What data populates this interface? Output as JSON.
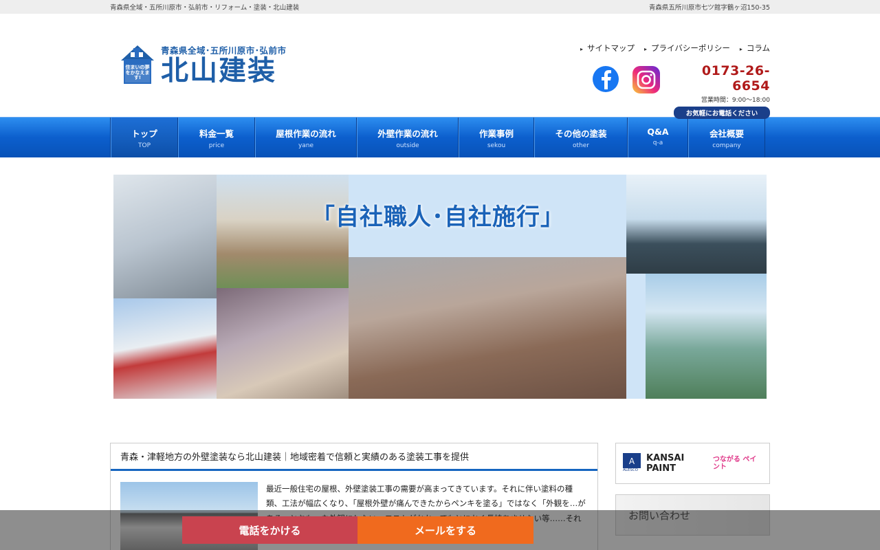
{
  "topbar": {
    "left": "青森県全域・五所川原市・弘前市・リフォーム・塗装・北山建装",
    "right": "青森県五所川原市七ツ館字鶴ヶ沼150-35"
  },
  "logo": {
    "sub": "青森県全域･五所川原市･弘前市",
    "main": "北山建装",
    "tagline": "住まいの夢をかなえます!"
  },
  "header_links": [
    "サイトマップ",
    "プライバシーポリシー",
    "コラム"
  ],
  "social": {
    "facebook": "facebook-icon",
    "instagram": "instagram-icon"
  },
  "contact": {
    "phone": "0173-26-6654",
    "hours": "営業時間：9:00〜18:00",
    "note": "お気軽にお電話ください"
  },
  "nav": [
    {
      "jp": "トップ",
      "en": "TOP"
    },
    {
      "jp": "料金一覧",
      "en": "price"
    },
    {
      "jp": "屋根作業の流れ",
      "en": "yane"
    },
    {
      "jp": "外壁作業の流れ",
      "en": "outside"
    },
    {
      "jp": "作業事例",
      "en": "sekou"
    },
    {
      "jp": "その他の塗装",
      "en": "other"
    },
    {
      "jp": "Q&A",
      "en": "q-a"
    },
    {
      "jp": "会社概要",
      "en": "company"
    }
  ],
  "hero": {
    "title": "「自社職人･自社施行」"
  },
  "main": {
    "title": "青森・津軽地方の外壁塗装なら北山建装｜地域密着で信頼と実績のある塗装工事を提供",
    "text": "最近一般住宅の屋根、外壁塗装工事の需要が高まってきています。それに伴い塗料の種類、工法が幅広くなり、「屋根外壁が痛んできたからペンキを塗る」ではなく「外観を…がある…とおも…な外観にしたい…コストがかかってもとにかく長持ちさせたい等……それをお客様と話し合いながら"
  },
  "side": {
    "kansai_name": "KANSAI PAINT",
    "kansai_sub": "ALESCO",
    "tsunagaru": "つながる ペイント",
    "toiawase": "お問い合わせ"
  },
  "cta": {
    "tel": "電話をかける",
    "mail": "メールをする"
  },
  "colors": {
    "brand_blue": "#1f5fa8",
    "nav_blue": "#0c5fcd",
    "phone_red": "#b01a1a",
    "cta_tel": "#c9434f",
    "cta_mail": "#f06a1e"
  }
}
